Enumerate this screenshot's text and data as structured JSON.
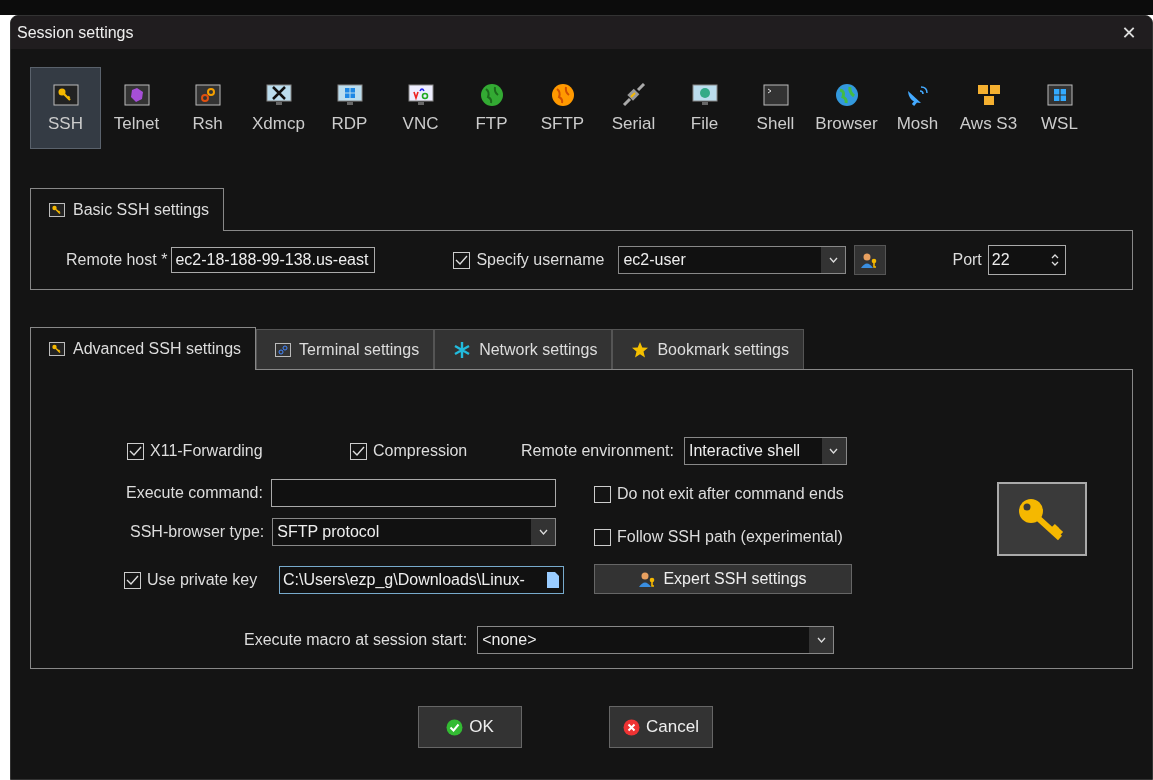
{
  "window": {
    "title": "Session settings",
    "close": "✕"
  },
  "protocols": [
    {
      "label": "SSH",
      "selected": true
    },
    {
      "label": "Telnet",
      "selected": false
    },
    {
      "label": "Rsh",
      "selected": false
    },
    {
      "label": "Xdmcp",
      "selected": false
    },
    {
      "label": "RDP",
      "selected": false
    },
    {
      "label": "VNC",
      "selected": false
    },
    {
      "label": "FTP",
      "selected": false
    },
    {
      "label": "SFTP",
      "selected": false
    },
    {
      "label": "Serial",
      "selected": false
    },
    {
      "label": "File",
      "selected": false
    },
    {
      "label": "Shell",
      "selected": false
    },
    {
      "label": "Browser",
      "selected": false
    },
    {
      "label": "Mosh",
      "selected": false
    },
    {
      "label": "Aws S3",
      "selected": false
    },
    {
      "label": "WSL",
      "selected": false
    }
  ],
  "basic_tabs": [
    {
      "label": "Basic SSH settings",
      "selected": true
    }
  ],
  "basic": {
    "remote_host": {
      "label": "Remote host *",
      "value": "ec2-18-188-99-138.us-east"
    },
    "specify_username": {
      "label": "Specify username",
      "checked": true
    },
    "username": {
      "value": "ec2-user"
    },
    "port": {
      "label": "Port",
      "value": "22"
    }
  },
  "advanced_tabs": [
    {
      "label": "Advanced SSH settings",
      "selected": true
    },
    {
      "label": "Terminal settings",
      "selected": false
    },
    {
      "label": "Network settings",
      "selected": false
    },
    {
      "label": "Bookmark settings",
      "selected": false
    }
  ],
  "advanced": {
    "x11_forwarding": {
      "label": "X11-Forwarding",
      "checked": true
    },
    "compression": {
      "label": "Compression",
      "checked": true
    },
    "remote_environment": {
      "label": "Remote environment:",
      "value": "Interactive shell"
    },
    "execute_command": {
      "label": "Execute command:"
    },
    "do_not_exit": {
      "label": "Do not exit after command ends",
      "checked": false
    },
    "ssh_browser_type": {
      "label": "SSH-browser type:",
      "value": "SFTP protocol"
    },
    "follow_ssh_path": {
      "label": "Follow SSH path (experimental)",
      "checked": false
    },
    "use_private_key": {
      "label": "Use private key",
      "checked": true,
      "value": "C:\\Users\\ezp_g\\Downloads\\Linux-"
    },
    "expert_button": "Expert SSH settings",
    "execute_macro": {
      "label": "Execute macro at session start:",
      "value": "<none>"
    }
  },
  "buttons": [
    {
      "label": "OK",
      "kind": "ok"
    },
    {
      "label": "Cancel",
      "kind": "cancel"
    }
  ]
}
